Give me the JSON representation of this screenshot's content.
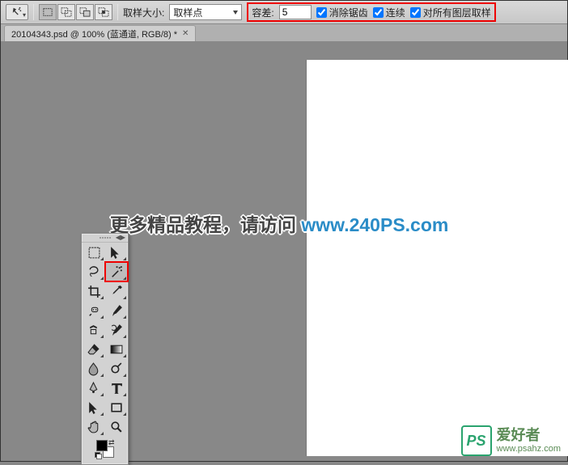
{
  "options_bar": {
    "sample_size_label": "取样大小:",
    "sample_size_value": "取样点",
    "tolerance_label": "容差:",
    "tolerance_value": "5",
    "antialias_label": "消除锯齿",
    "antialias_checked": true,
    "contiguous_label": "连续",
    "contiguous_checked": true,
    "all_layers_label": "对所有图层取样",
    "all_layers_checked": true
  },
  "document": {
    "tab_title": "20104343.psd @ 100% (蓝通道, RGB/8) *"
  },
  "watermark": {
    "text": "更多精品教程，请访问 ",
    "url": "www.240PS.com"
  },
  "tools": {
    "list": [
      {
        "name": "marquee-tool",
        "flyout": true
      },
      {
        "name": "move-tool",
        "flyout": true
      },
      {
        "name": "lasso-tool",
        "flyout": true
      },
      {
        "name": "magic-wand-tool",
        "flyout": true,
        "selected": true,
        "highlight": true
      },
      {
        "name": "crop-tool",
        "flyout": true
      },
      {
        "name": "eyedropper-tool",
        "flyout": true
      },
      {
        "name": "healing-brush-tool",
        "flyout": true
      },
      {
        "name": "brush-tool",
        "flyout": true
      },
      {
        "name": "clone-stamp-tool",
        "flyout": true
      },
      {
        "name": "history-brush-tool",
        "flyout": true
      },
      {
        "name": "eraser-tool",
        "flyout": true
      },
      {
        "name": "gradient-tool",
        "flyout": true
      },
      {
        "name": "blur-tool",
        "flyout": true
      },
      {
        "name": "dodge-tool",
        "flyout": true
      },
      {
        "name": "pen-tool",
        "flyout": true
      },
      {
        "name": "type-tool",
        "flyout": true
      },
      {
        "name": "path-selection-tool",
        "flyout": true
      },
      {
        "name": "shape-tool",
        "flyout": true
      },
      {
        "name": "hand-tool",
        "flyout": true
      },
      {
        "name": "zoom-tool",
        "flyout": false
      }
    ]
  },
  "brand": {
    "badge": "PS",
    "line1": "爱好者",
    "line2": "www.psahz.com"
  }
}
